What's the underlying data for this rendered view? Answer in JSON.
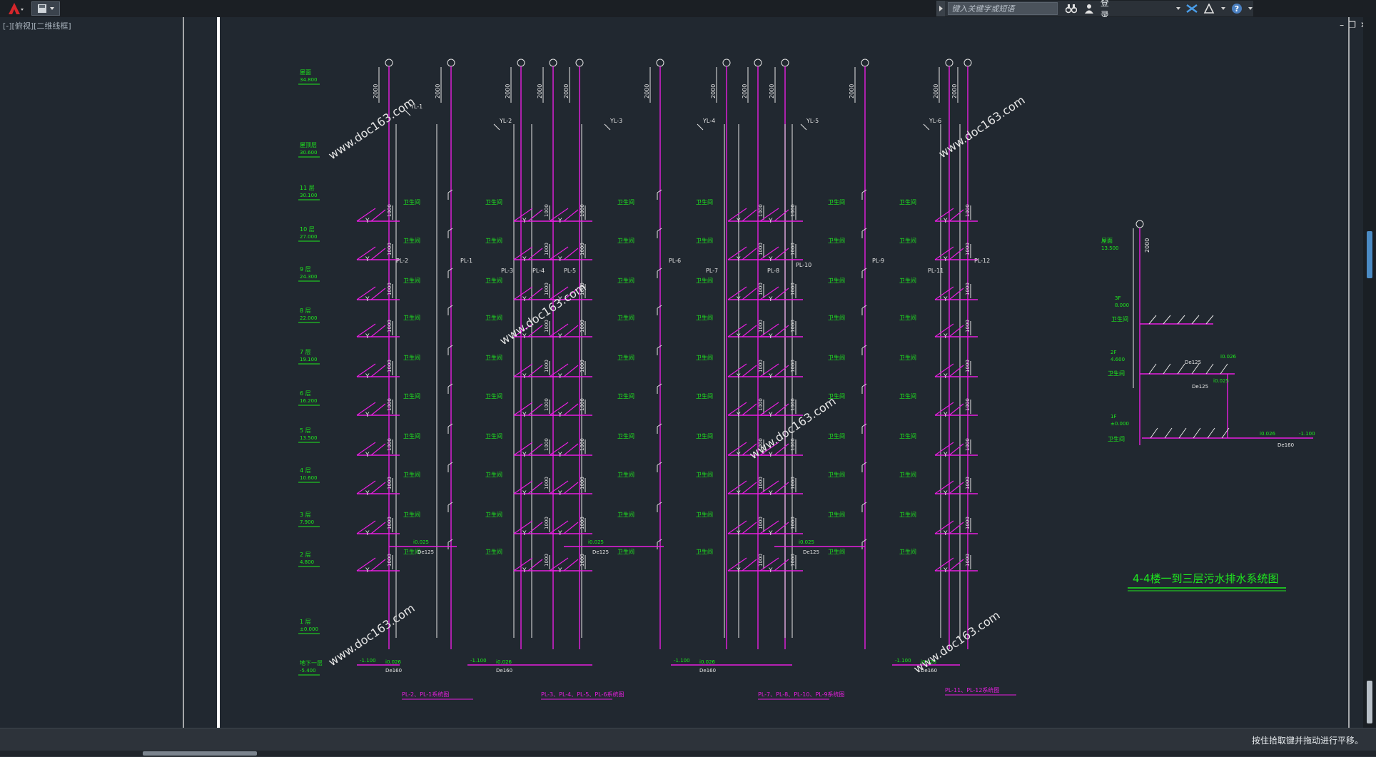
{
  "titlebar": {
    "search_placeholder": "键入关键字或短语",
    "login_label": "登录"
  },
  "viewport": {
    "tag": "[-][俯视][二维线框]"
  },
  "drawing": {
    "left_floor_labels": [
      {
        "name": "屋面",
        "elev": "34.800"
      },
      {
        "name": "屋顶层",
        "elev": "30.600"
      },
      {
        "name": "11 层",
        "elev": "30.100"
      },
      {
        "name": "10 层",
        "elev": "27.000"
      },
      {
        "name": "9 层",
        "elev": "24.300"
      },
      {
        "name": "8 层",
        "elev": "22.000"
      },
      {
        "name": "7 层",
        "elev": "19.100"
      },
      {
        "name": "6 层",
        "elev": "16.200"
      },
      {
        "name": "5 层",
        "elev": "13.500"
      },
      {
        "name": "4 层",
        "elev": "10.600"
      },
      {
        "name": "3 层",
        "elev": "7.900"
      },
      {
        "name": "2 层",
        "elev": "4.800"
      },
      {
        "name": "1 层",
        "elev": "±0.000"
      },
      {
        "name": "地下一层",
        "elev": "-5.400"
      }
    ],
    "riser_labels": [
      "YL-1",
      "YL-2",
      "YL-3",
      "YL-4",
      "YL-5",
      "YL-6"
    ],
    "pl_labels": [
      "PL-1",
      "PL-2",
      "PL-3",
      "PL-4",
      "PL-5",
      "PL-6",
      "PL-7",
      "PL-8",
      "PL-9",
      "PL-10",
      "PL-11",
      "PL-12"
    ],
    "system_titles": [
      "PL-2、PL-1系统图",
      "PL-3、PL-4、PL-5、PL-6系统图",
      "PL-7、PL-8、PL-10、PL-9系统图",
      "PL-11、PL-12系统图"
    ],
    "right_title": "4-4楼一到三层污水排水系统图",
    "right_labels": {
      "roof": "屋面",
      "roof_elev": "13.500",
      "f3": "3F",
      "f3_elev": "8.000",
      "f2": "2F",
      "f2_elev": "4.600",
      "f1": "1F",
      "f1_elev": "±0.000",
      "slope1": "i0.026",
      "slope2": "i0.025",
      "slope3": "i0.026",
      "end_elev": "-1.100",
      "pipe1": "De125",
      "pipe2": "De125",
      "pipe3": "De160"
    },
    "bathroom_label": "卫生间",
    "dim_2000": "2000",
    "dim_1000": "1000",
    "watermark": "www.doc163.com"
  },
  "status": {
    "text": "按住拾取键并拖动进行平移。"
  },
  "colors": {
    "magenta": "#e81ee0",
    "green": "#1eea1e",
    "white": "#e6e6e6",
    "background": "#212830"
  }
}
